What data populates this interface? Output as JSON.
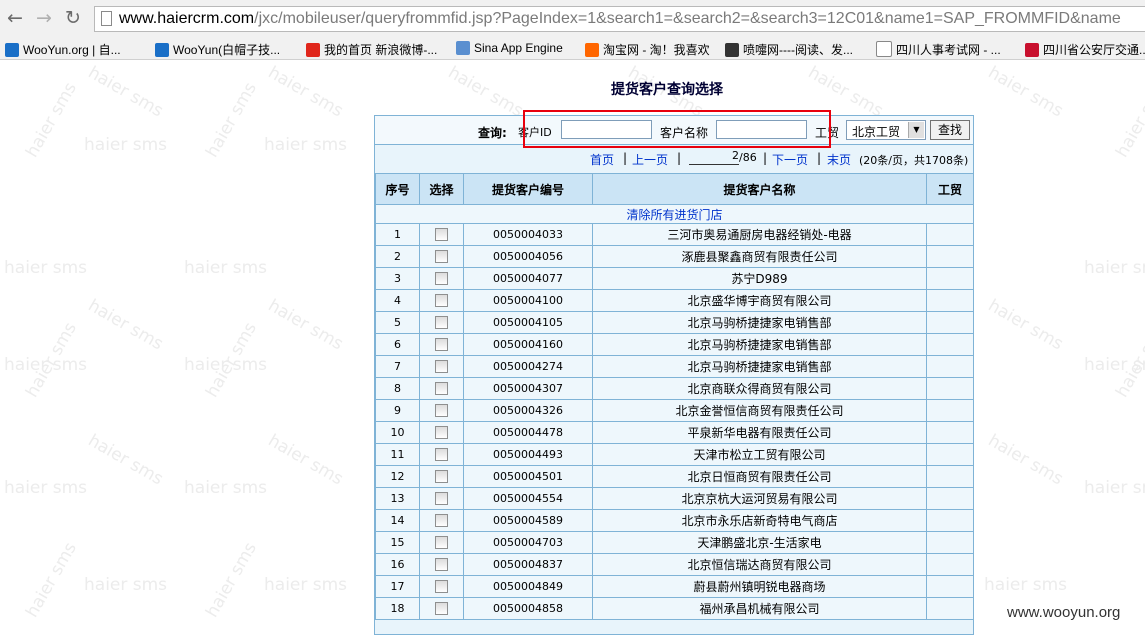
{
  "browser": {
    "url_host": "www.haiercrm.com",
    "url_rest": "/jxc/mobileuser/queryfrommfid.jsp?PageIndex=1&search1=&search2=&search3=12C01&name1=SAP_FROMMFID&name",
    "bookmarks": [
      {
        "label": "WooYun.org | 自...",
        "icon": "wooyun-icon",
        "color": "#1a6fc7"
      },
      {
        "label": "WooYun(白帽子技...",
        "icon": "wooyun-icon",
        "color": "#1a6fc7"
      },
      {
        "label": "我的首页 新浪微博-...",
        "icon": "weibo-icon",
        "color": "#e0261b"
      },
      {
        "label": "Sina App Engine",
        "icon": "cloud-icon",
        "color": "#5a8fd0"
      },
      {
        "label": "淘宝网 - 淘！我喜欢",
        "icon": "taobao-icon",
        "color": "#ff6600"
      },
      {
        "label": "喷嚏网----阅读、发...",
        "icon": "pentie-icon",
        "color": "#333333"
      },
      {
        "label": "四川人事考试网 - ...",
        "icon": "page-icon",
        "color": "#ffffff"
      },
      {
        "label": "四川省公安厅交通...",
        "icon": "police-icon",
        "color": "#c8102e"
      }
    ]
  },
  "watermark": "haier sms",
  "page": {
    "title": "提货客户查询选择",
    "search": {
      "label": "查询:",
      "customer_id_label": "客户ID",
      "customer_id_value": "",
      "customer_name_label": "客户名称",
      "customer_name_value": "",
      "trade_label": "工贸",
      "trade_selected": "北京工贸",
      "search_button": "查找"
    },
    "pager": {
      "first": "首页",
      "prev": "上一页",
      "sep": "|",
      "page_value": "2",
      "page_total": "/86",
      "next": "下一页",
      "last": "末页",
      "summary": "(20条/页，共1708条)"
    },
    "table": {
      "headers": [
        "序号",
        "选择",
        "提货客户编号",
        "提货客户名称",
        "工贸"
      ],
      "clear_link": "清除所有进货门店",
      "rows": [
        {
          "no": "1",
          "id": "0050004033",
          "name": "三河市奥易通厨房电器经销处-电器"
        },
        {
          "no": "2",
          "id": "0050004056",
          "name": "涿鹿县聚鑫商贸有限责任公司"
        },
        {
          "no": "3",
          "id": "0050004077",
          "name": "苏宁D989"
        },
        {
          "no": "4",
          "id": "0050004100",
          "name": "北京盛华博宇商贸有限公司"
        },
        {
          "no": "5",
          "id": "0050004105",
          "name": "北京马驹桥捷捷家电销售部"
        },
        {
          "no": "6",
          "id": "0050004160",
          "name": "北京马驹桥捷捷家电销售部"
        },
        {
          "no": "7",
          "id": "0050004274",
          "name": "北京马驹桥捷捷家电销售部"
        },
        {
          "no": "8",
          "id": "0050004307",
          "name": "北京商联众得商贸有限公司"
        },
        {
          "no": "9",
          "id": "0050004326",
          "name": "北京金誉恒信商贸有限责任公司"
        },
        {
          "no": "10",
          "id": "0050004478",
          "name": "平泉新华电器有限责任公司"
        },
        {
          "no": "11",
          "id": "0050004493",
          "name": "天津市松立工贸有限公司"
        },
        {
          "no": "12",
          "id": "0050004501",
          "name": "北京日恒商贸有限责任公司"
        },
        {
          "no": "13",
          "id": "0050004554",
          "name": "北京京杭大运河贸易有限公司"
        },
        {
          "no": "14",
          "id": "0050004589",
          "name": "北京市永乐店新奇特电气商店"
        },
        {
          "no": "15",
          "id": "0050004703",
          "name": "天津鹏盛北京-生活家电"
        },
        {
          "no": "16",
          "id": "0050004837",
          "name": "北京恒信瑞达商贸有限公司"
        },
        {
          "no": "17",
          "id": "0050004849",
          "name": "蔚县蔚州镇明锐电器商场"
        },
        {
          "no": "18",
          "id": "0050004858",
          "name": "福州承昌机械有限公司"
        }
      ]
    }
  },
  "footer_watermark": "www.wooyun.org",
  "colors": {
    "highlight_box": "#e8000d",
    "link": "#0033cc",
    "header_bg": "#cbe4f5"
  }
}
